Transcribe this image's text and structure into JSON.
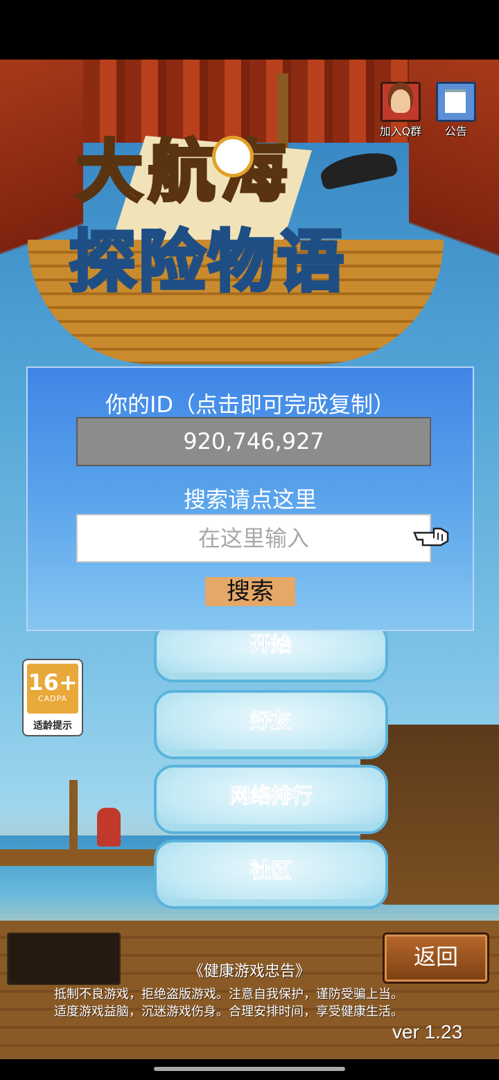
{
  "top_icons": {
    "join_qq_group": "加入Q群",
    "announcement": "公告"
  },
  "logo": {
    "line1": "大航海",
    "line2": "探险物语"
  },
  "id_panel": {
    "title": "你的ID（点击即可完成复制）",
    "id_value": "920,746,927",
    "search_label": "搜索请点这里",
    "search_placeholder": "在这里输入",
    "search_button": "搜索"
  },
  "menu": {
    "start": "开始",
    "friends": "好友",
    "ranking": "网络排行",
    "community": "社区"
  },
  "age_rating": {
    "age": "16+",
    "org": "CADPA",
    "label": "适龄提示"
  },
  "footer": {
    "back_button": "返回",
    "health_title": "《健康游戏忠告》",
    "health_line1": "抵制不良游戏，拒绝盗版游戏。注意自我保护，谨防受骗上当。",
    "health_line2": "适度游戏益脑，沉迷游戏伤身。合理安排时间，享受健康生活。",
    "version": "ver 1.23"
  }
}
